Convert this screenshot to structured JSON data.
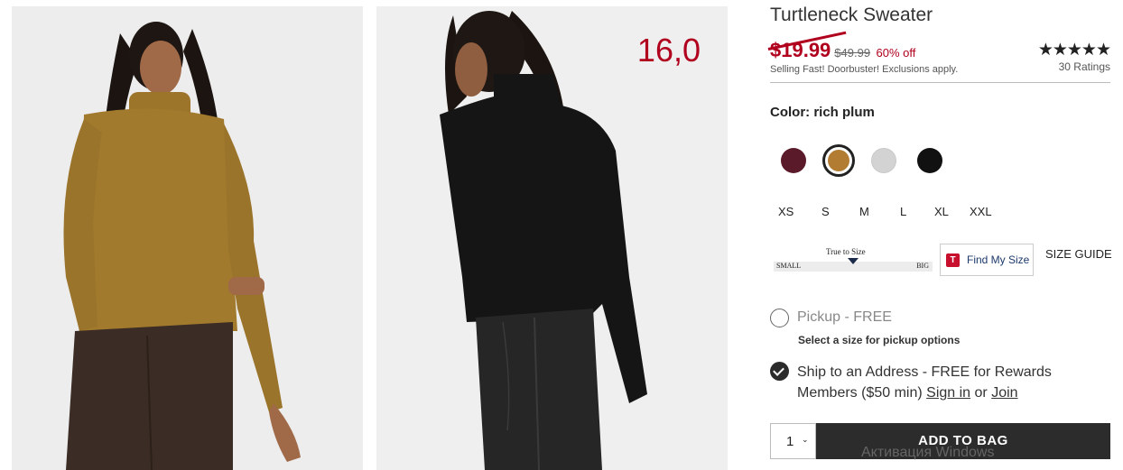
{
  "gallery": {
    "overlay_price": "16,0",
    "photos": [
      {
        "sweater_color": "#a27a2e",
        "background": "#eeeeee"
      },
      {
        "sweater_color": "#151515",
        "background": "#efefef"
      }
    ]
  },
  "product": {
    "title": "Turtleneck Sweater",
    "sale_price": "$19.99",
    "original_price": "$49.99",
    "discount": "60% off",
    "promo": "Selling Fast! Doorbuster! Exclusions apply.",
    "rating": {
      "stars": "★★★★★",
      "value": 4.5,
      "count_label": "30 Ratings"
    }
  },
  "color": {
    "label": "Color: rich plum",
    "swatches": [
      {
        "name": "rich plum",
        "hex": "#5a1a2a",
        "selected": false
      },
      {
        "name": "camel",
        "hex": "#b27d33",
        "selected": true
      },
      {
        "name": "light heather grey",
        "hex": "#d3d3d3",
        "selected": false
      },
      {
        "name": "black",
        "hex": "#111111",
        "selected": false
      }
    ]
  },
  "sizes": [
    "XS",
    "S",
    "M",
    "L",
    "XL",
    "XXL"
  ],
  "fit": {
    "center_label": "True to Size",
    "min_label": "SMALL",
    "max_label": "BIG",
    "level": 0.5
  },
  "find_my_size": {
    "icon_letter": "T",
    "label": "Find My Size"
  },
  "size_guide": "SIZE GUIDE",
  "fulfillment": {
    "pickup_label": "Pickup - FREE",
    "pickup_note": "Select a size for pickup options",
    "ship_text": "Ship to an Address - FREE for Rewards Members ($50 min)",
    "sign_in": "Sign in",
    "or": "or",
    "join": "Join"
  },
  "cart": {
    "quantity": "1",
    "chevron": "⌄",
    "add_label": "ADD TO BAG"
  },
  "os_watermark": "Активация Windows"
}
